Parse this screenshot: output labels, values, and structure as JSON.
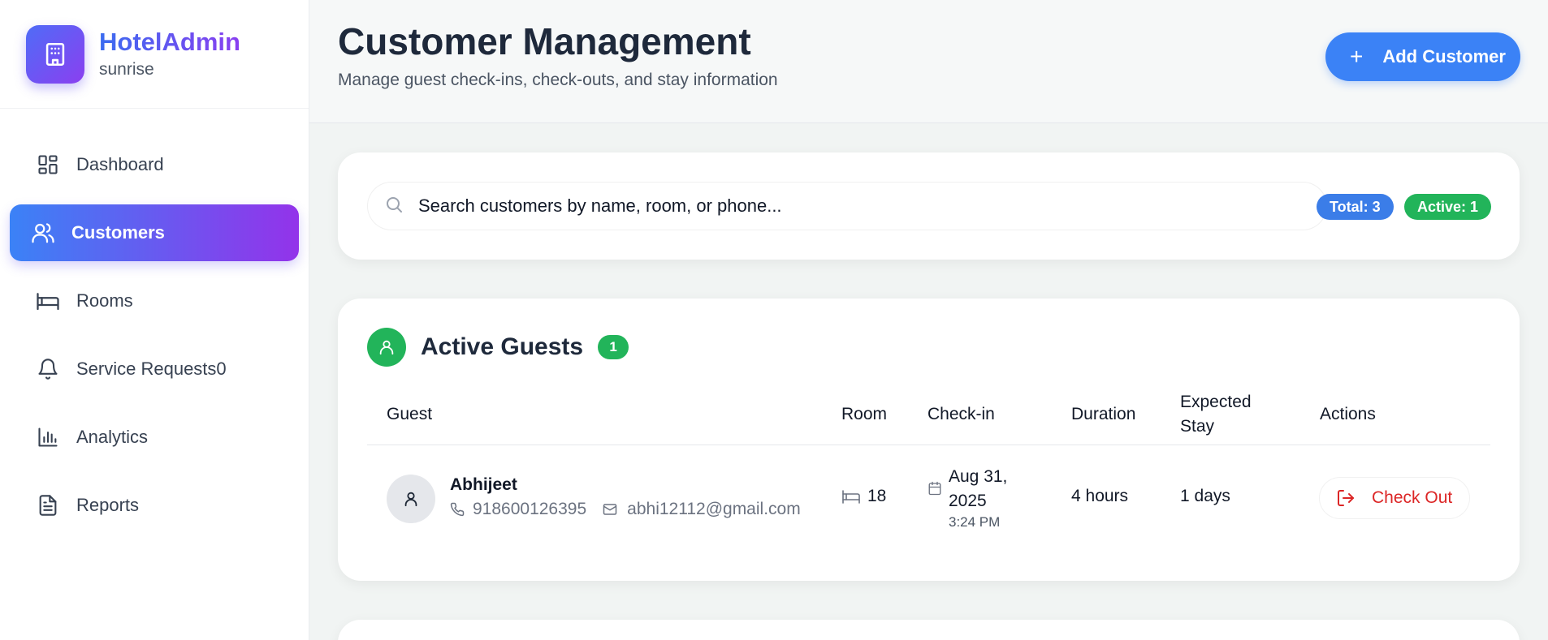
{
  "brand": {
    "name": "HotelAdmin",
    "subtitle": "sunrise"
  },
  "sidebar": {
    "items": [
      {
        "label": "Dashboard",
        "icon": "dashboard-grid-icon"
      },
      {
        "label": "Customers",
        "icon": "users-icon",
        "active": true
      },
      {
        "label": "Rooms",
        "icon": "bed-icon"
      },
      {
        "label": "Service Requests0",
        "icon": "bell-icon"
      },
      {
        "label": "Analytics",
        "icon": "bar-chart-icon"
      },
      {
        "label": "Reports",
        "icon": "document-icon"
      }
    ]
  },
  "header": {
    "title": "Customer Management",
    "subtitle": "Manage guest check-ins, check-outs, and stay information",
    "add_button": "Add Customer"
  },
  "search": {
    "placeholder": "Search customers by name, room, or phone...",
    "total_badge": "Total: 3",
    "active_badge": "Active: 1"
  },
  "active_guests": {
    "title": "Active Guests",
    "count": "1",
    "columns": {
      "guest": "Guest",
      "room": "Room",
      "checkin": "Check-in",
      "duration": "Duration",
      "expected_stay_1": "Expected",
      "expected_stay_2": "Stay",
      "actions": "Actions"
    },
    "rows": [
      {
        "name": "Abhijeet",
        "phone": "918600126395",
        "email": "abhi12112@gmail.com",
        "room": "18",
        "checkin_date_1": "Aug 31,",
        "checkin_date_2": "2025",
        "checkin_time": "3:24 PM",
        "duration": "4 hours",
        "expected_stay": "1 days",
        "action": "Check Out"
      }
    ]
  },
  "colors": {
    "accent_blue": "#3b82f6",
    "accent_purple": "#9333ea",
    "success_green": "#22b45a",
    "danger_red": "#dc2626"
  }
}
